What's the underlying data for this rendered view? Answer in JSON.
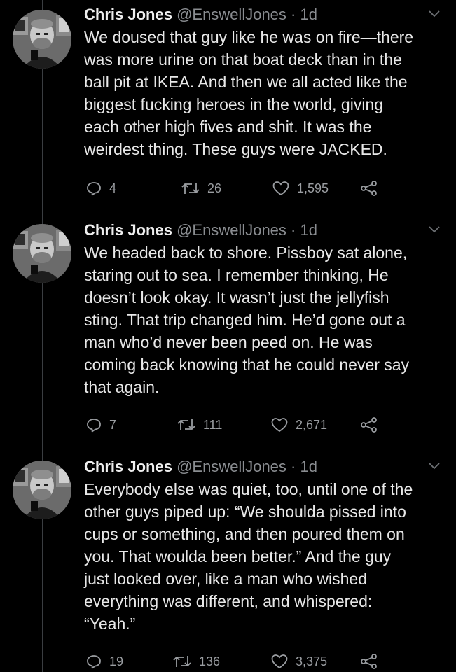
{
  "colors": {
    "background": "#000000",
    "text": "#e8e8e8",
    "muted": "#8a8d91",
    "thread_line": "#3a3d41"
  },
  "tweets": [
    {
      "name": "Chris Jones",
      "handle": "@EnswellJones",
      "separator": "·",
      "time": "1d",
      "lines": [
        "We doused that guy like he was on fire—there",
        "was more urine on that boat deck than in the",
        "ball pit at IKEA. And then we all acted like the",
        "biggest fucking heroes in the world, giving",
        "each other high fives and shit. It was the",
        "weirdest thing. These guys were JACKED."
      ],
      "replies": "4",
      "retweets": "26",
      "likes": "1,595",
      "icons": [
        "reply-icon",
        "retweet-icon",
        "heart-icon",
        "share-icon",
        "chevron-down-icon"
      ]
    },
    {
      "name": "Chris Jones",
      "handle": "@EnswellJones",
      "separator": "·",
      "time": "1d",
      "lines": [
        "We headed back to shore. Pissboy sat alone,",
        "staring out to sea. I remember thinking, He",
        "doesn’t look okay. It wasn’t just the jellyfish",
        "sting. That trip changed him. He’d gone out a",
        "man who’d never been peed on. He was",
        "coming back knowing that he could never say",
        "that again."
      ],
      "replies": "7",
      "retweets": "111",
      "likes": "2,671",
      "icons": [
        "reply-icon",
        "retweet-icon",
        "heart-icon",
        "share-icon",
        "chevron-down-icon"
      ]
    },
    {
      "name": "Chris Jones",
      "handle": "@EnswellJones",
      "separator": "·",
      "time": "1d",
      "lines": [
        "Everybody else was quiet, too, until one of the",
        "other guys piped up: “We shoulda pissed into",
        "cups or something, and then poured them on",
        "you. That woulda been better.” And the guy",
        "just looked over, like a man who wished",
        "everything was different, and whispered:",
        "“Yeah.”"
      ],
      "replies": "19",
      "retweets": "136",
      "likes": "3,375",
      "icons": [
        "reply-icon",
        "retweet-icon",
        "heart-icon",
        "share-icon",
        "chevron-down-icon"
      ]
    }
  ]
}
